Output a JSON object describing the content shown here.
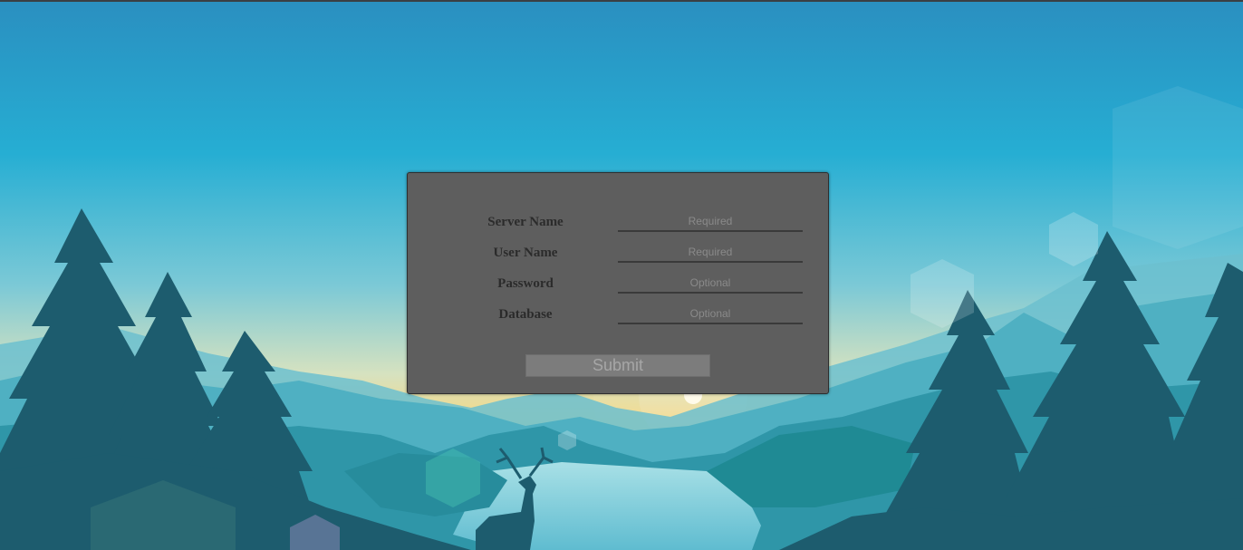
{
  "login_form": {
    "fields": [
      {
        "label": "Server Name",
        "placeholder": "Required",
        "value": ""
      },
      {
        "label": "User Name",
        "placeholder": "Required",
        "value": ""
      },
      {
        "label": "Password",
        "placeholder": "Optional",
        "value": ""
      },
      {
        "label": "Database",
        "placeholder": "Optional",
        "value": ""
      }
    ],
    "submit_label": "Submit"
  },
  "colors": {
    "panel": "#5e5e5e",
    "sky_top": "#2a9cc8",
    "sky_horizon": "#f2d98a",
    "mountains": "#3fa6b8",
    "forest": "#1c5b6e"
  }
}
